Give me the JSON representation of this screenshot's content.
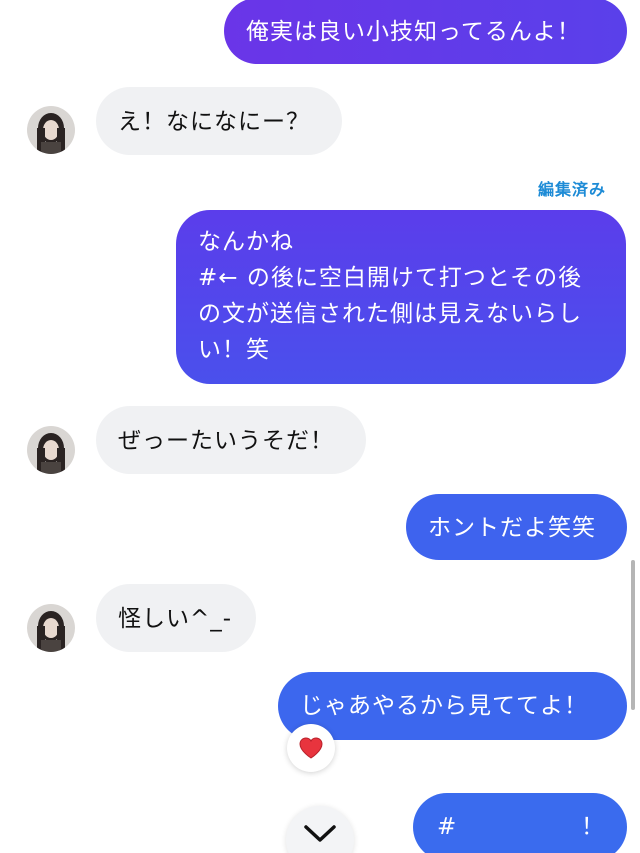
{
  "colors": {
    "accent": "#1d8bd6",
    "out_gradient_start": "#6a35e8",
    "out_gradient_end": "#3461ec",
    "out_solid": "#3d66ee"
  },
  "messages": {
    "m1": "俺実は良い小技知ってるんよ！",
    "m2": "え！なになにー？",
    "edited_label": "編集済み",
    "m3_line1": "なんかね",
    "m3_line2": " #← の後に空白開けて打つとその後",
    "m3_line3": "の文が送信された側は見えないらし",
    "m3_line4": "い！笑",
    "m4": "ぜっーたいうそだ！",
    "m5": "ホントだよ笑笑",
    "m6": "怪しい^_-",
    "m7": "じゃあやるから見ててよ！",
    "m8_hash": "#",
    "m8_excl": "！"
  },
  "icons": {
    "reaction": "heart-icon",
    "scroll_down": "chevron-down-icon",
    "avatar": "contact-avatar"
  }
}
